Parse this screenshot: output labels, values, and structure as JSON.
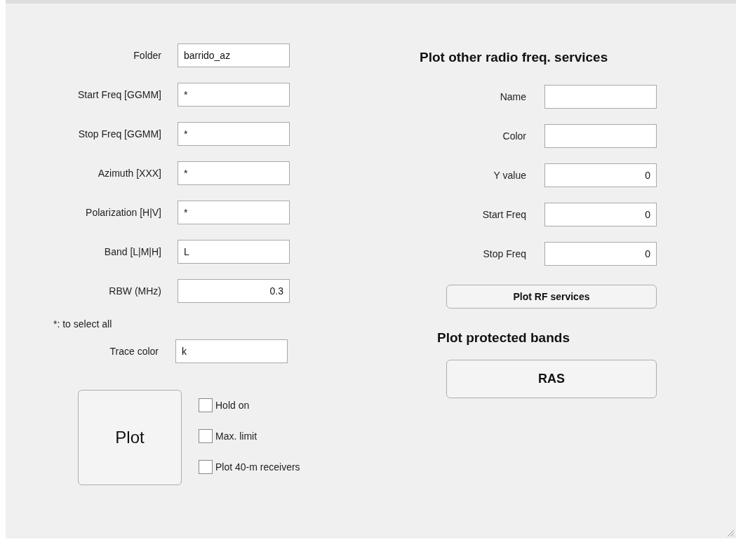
{
  "left_fields": [
    {
      "label": "Folder",
      "value": "barrido_az",
      "kind": "text"
    },
    {
      "label": "Start Freq [GGMM]",
      "value": "*",
      "kind": "text"
    },
    {
      "label": "Stop Freq [GGMM]",
      "value": "*",
      "kind": "text"
    },
    {
      "label": "Azimuth [XXX]",
      "value": "*",
      "kind": "text"
    },
    {
      "label": "Polarization [H|V]",
      "value": "*",
      "kind": "text"
    },
    {
      "label": "Band [L|M|H]",
      "value": "L",
      "kind": "text"
    },
    {
      "label": "RBW (MHz)",
      "value": "0.3",
      "kind": "number"
    }
  ],
  "note": "*: to select all",
  "trace_color": {
    "label": "Trace color",
    "value": "k"
  },
  "plot_button": "Plot",
  "checkboxes": [
    {
      "label": "Hold on",
      "checked": false
    },
    {
      "label": "Max. limit",
      "checked": false
    },
    {
      "label": "Plot 40-m receivers",
      "checked": false
    }
  ],
  "rf_services": {
    "title": "Plot other radio freq. services",
    "fields": [
      {
        "label": "Name",
        "kind": "text"
      },
      {
        "label": "Color",
        "kind": "text"
      },
      {
        "label": "Y value",
        "value": "0",
        "kind": "number"
      },
      {
        "label": "Start Freq",
        "value": "0",
        "kind": "number"
      },
      {
        "label": "Stop Freq",
        "value": "0",
        "kind": "number"
      }
    ],
    "button": "Plot RF services"
  },
  "protected_bands": {
    "title": "Plot protected bands",
    "button": "RAS"
  }
}
